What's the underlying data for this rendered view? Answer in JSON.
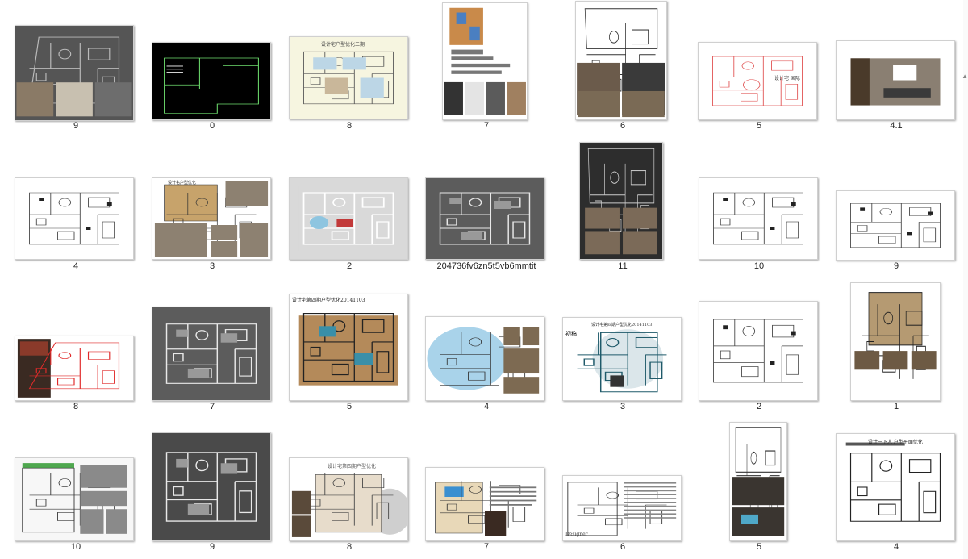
{
  "window": {
    "view": "Large icons"
  },
  "files": [
    {
      "label": "9",
      "style": "dark-plan-photos"
    },
    {
      "label": "0",
      "style": "cad-green"
    },
    {
      "label": "8",
      "style": "beige-colorplan"
    },
    {
      "label": "7",
      "style": "portrait-color-plan"
    },
    {
      "label": "6",
      "style": "portrait-plan-photos"
    },
    {
      "label": "5",
      "style": "red-sketch"
    },
    {
      "label": "4.1",
      "style": "photo-room"
    },
    {
      "label": "4",
      "style": "white-plan"
    },
    {
      "label": "3",
      "style": "color-plan-photos"
    },
    {
      "label": "2",
      "style": "gray-color-plan"
    },
    {
      "label": "204736fv6zn5t5vb6mmtit",
      "style": "dark-gray-plan"
    },
    {
      "label": "11",
      "style": "dark-portrait-photos"
    },
    {
      "label": "10",
      "style": "white-plan"
    },
    {
      "label": "9",
      "style": "white-plan"
    },
    {
      "label": "8",
      "style": "red-dark-plan"
    },
    {
      "label": "7",
      "style": "dark-gray-plan"
    },
    {
      "label": "5",
      "style": "brown-color-plan"
    },
    {
      "label": "4",
      "style": "blue-wash-plan"
    },
    {
      "label": "3",
      "style": "teal-plan"
    },
    {
      "label": "2",
      "style": "white-plan"
    },
    {
      "label": "1",
      "style": "portrait-plan-photos2"
    },
    {
      "label": "10",
      "style": "green-plan-photos"
    },
    {
      "label": "9",
      "style": "dark-gray-plan2"
    },
    {
      "label": "8",
      "style": "ink-plan"
    },
    {
      "label": "7",
      "style": "blue-color-plan-text"
    },
    {
      "label": "6",
      "style": "plan-text"
    },
    {
      "label": "5",
      "style": "portrait-plan-nightphoto"
    },
    {
      "label": "4",
      "style": "white-plan-title"
    }
  ],
  "thumb_texts": {
    "t2_title": "设计宅户型优化二期",
    "t3_title": "设计宅户型优化",
    "t5_title": "设计宅  国际",
    "t17_title": "设计宅第四期户型优化20141103",
    "t19_title": "初稿",
    "t20_title": "设计宅第四期户型优化20141103",
    "t28_title": "设计宅第四期户型优化",
    "t31_title": "宅",
    "t31_sub": "Designer",
    "t32_title": "设计一下人  户型平面优化"
  }
}
